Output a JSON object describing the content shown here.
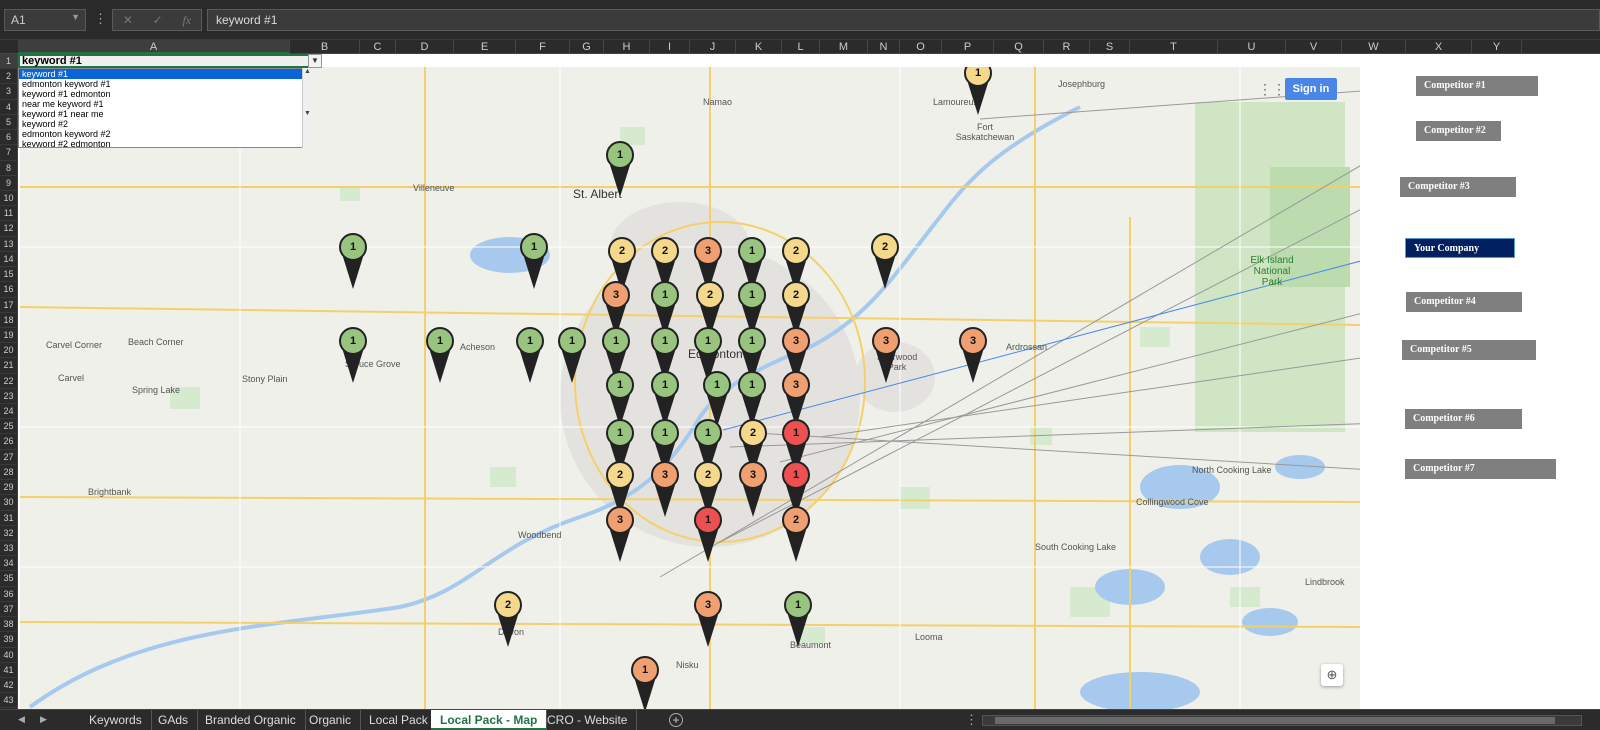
{
  "formula_bar": {
    "name_box": "A1",
    "cancel_icon": "✕",
    "enter_icon": "✓",
    "function_label": "fx",
    "formula": "keyword #1"
  },
  "columns": [
    "A",
    "B",
    "C",
    "D",
    "E",
    "F",
    "G",
    "H",
    "I",
    "J",
    "K",
    "L",
    "M",
    "N",
    "O",
    "P",
    "Q",
    "R",
    "S",
    "T",
    "U",
    "V",
    "W",
    "X",
    "Y"
  ],
  "rows": [
    "1",
    "2",
    "3",
    "4",
    "5",
    "6",
    "7",
    "8",
    "9",
    "10",
    "11",
    "12",
    "13",
    "14",
    "15",
    "16",
    "17",
    "18",
    "19",
    "20",
    "21",
    "22",
    "23",
    "24",
    "25",
    "26",
    "27",
    "28",
    "29",
    "30",
    "31",
    "32",
    "33",
    "34",
    "35",
    "36",
    "37",
    "38",
    "39",
    "40",
    "41",
    "42",
    "43"
  ],
  "cell_a1": "keyword #1",
  "dropdown_options": [
    "keyword #1",
    "edmonton keyword #1",
    "keyword #1 edmonton",
    "near me keyword #1",
    "keyword #1 near me",
    "keyword #2",
    "edmonton keyword #2",
    "keyword #2 edmonton"
  ],
  "map": {
    "sign_in": "Sign in",
    "places": [
      {
        "name": "Josephburg"
      },
      {
        "name": "Lamoureux"
      },
      {
        "name": "Fort Saskatchewan"
      },
      {
        "name": "Namao"
      },
      {
        "name": "St. Albert"
      },
      {
        "name": "Villeneuve"
      },
      {
        "name": "Edmonton"
      },
      {
        "name": "Acheson"
      },
      {
        "name": "Spruce Grove"
      },
      {
        "name": "Stony Plain"
      },
      {
        "name": "Carvel Corner"
      },
      {
        "name": "Beach Corner"
      },
      {
        "name": "Carvel"
      },
      {
        "name": "Spring Lake"
      },
      {
        "name": "Sherwood Park"
      },
      {
        "name": "Ardrossan"
      },
      {
        "name": "Elk Island National Park"
      },
      {
        "name": "Brightbank"
      },
      {
        "name": "Woodbend"
      },
      {
        "name": "Devon"
      },
      {
        "name": "Nisku"
      },
      {
        "name": "Beaumont"
      },
      {
        "name": "Looma"
      },
      {
        "name": "North Cooking Lake"
      },
      {
        "name": "Collingwood Cove"
      },
      {
        "name": "South Cooking Lake"
      },
      {
        "name": "Lindbrook"
      }
    ],
    "pins": [
      {
        "rank": "1",
        "color": "#f4d88c"
      },
      {
        "rank": "1",
        "color": "#98c480"
      },
      {
        "rank": "1",
        "color": "#98c480"
      },
      {
        "rank": "1",
        "color": "#98c480"
      },
      {
        "rank": "2",
        "color": "#f4d88c"
      },
      {
        "rank": "2",
        "color": "#f4d88c"
      },
      {
        "rank": "3",
        "color": "#f0a070"
      },
      {
        "rank": "1",
        "color": "#98c480"
      },
      {
        "rank": "2",
        "color": "#f4d88c"
      },
      {
        "rank": "2",
        "color": "#f4d88c"
      },
      {
        "rank": "3",
        "color": "#f0a070"
      },
      {
        "rank": "1",
        "color": "#98c480"
      },
      {
        "rank": "2",
        "color": "#f4d88c"
      },
      {
        "rank": "1",
        "color": "#98c480"
      },
      {
        "rank": "2",
        "color": "#f4d88c"
      },
      {
        "rank": "1",
        "color": "#98c480"
      },
      {
        "rank": "1",
        "color": "#98c480"
      },
      {
        "rank": "1",
        "color": "#98c480"
      },
      {
        "rank": "1",
        "color": "#98c480"
      },
      {
        "rank": "1",
        "color": "#98c480"
      },
      {
        "rank": "1",
        "color": "#98c480"
      },
      {
        "rank": "1",
        "color": "#98c480"
      },
      {
        "rank": "1",
        "color": "#98c480"
      },
      {
        "rank": "3",
        "color": "#f0a070"
      },
      {
        "rank": "3",
        "color": "#f0a070"
      },
      {
        "rank": "3",
        "color": "#f0a070"
      },
      {
        "rank": "1",
        "color": "#98c480"
      },
      {
        "rank": "1",
        "color": "#98c480"
      },
      {
        "rank": "1",
        "color": "#98c480"
      },
      {
        "rank": "1",
        "color": "#98c480"
      },
      {
        "rank": "3",
        "color": "#f0a070"
      },
      {
        "rank": "1",
        "color": "#98c480"
      },
      {
        "rank": "1",
        "color": "#98c480"
      },
      {
        "rank": "1",
        "color": "#98c480"
      },
      {
        "rank": "2",
        "color": "#f4d88c"
      },
      {
        "rank": "1",
        "color": "#ec5050"
      },
      {
        "rank": "2",
        "color": "#f4d88c"
      },
      {
        "rank": "3",
        "color": "#f0a070"
      },
      {
        "rank": "2",
        "color": "#f4d88c"
      },
      {
        "rank": "3",
        "color": "#f0a070"
      },
      {
        "rank": "1",
        "color": "#ec5050"
      },
      {
        "rank": "3",
        "color": "#f0a070"
      },
      {
        "rank": "1",
        "color": "#ec5050"
      },
      {
        "rank": "2",
        "color": "#f0a070"
      },
      {
        "rank": "2",
        "color": "#f4d88c"
      },
      {
        "rank": "3",
        "color": "#f0a070"
      },
      {
        "rank": "1",
        "color": "#98c480"
      },
      {
        "rank": "1",
        "color": "#f0a070"
      }
    ]
  },
  "competitors": [
    {
      "label": "Competitor #1"
    },
    {
      "label": "Competitor #2"
    },
    {
      "label": "Competitor #3"
    },
    {
      "label": "Your Company",
      "highlight": true
    },
    {
      "label": "Competitor #4"
    },
    {
      "label": "Competitor #5"
    },
    {
      "label": "Competitor #6"
    },
    {
      "label": "Competitor #7"
    }
  ],
  "tabs": [
    {
      "label": "Keywords"
    },
    {
      "label": "GAds"
    },
    {
      "label": "Branded Organic"
    },
    {
      "label": "Organic"
    },
    {
      "label": "Local Pack"
    },
    {
      "label": "Local Pack - Map",
      "active": true
    },
    {
      "label": "CRO - Website"
    }
  ],
  "colors": {
    "rank1": "#98c480",
    "rank2": "#f4d88c",
    "rank3": "#f0a070",
    "bad": "#ec5050",
    "excel_green": "#217346",
    "your_company": "#002060"
  }
}
